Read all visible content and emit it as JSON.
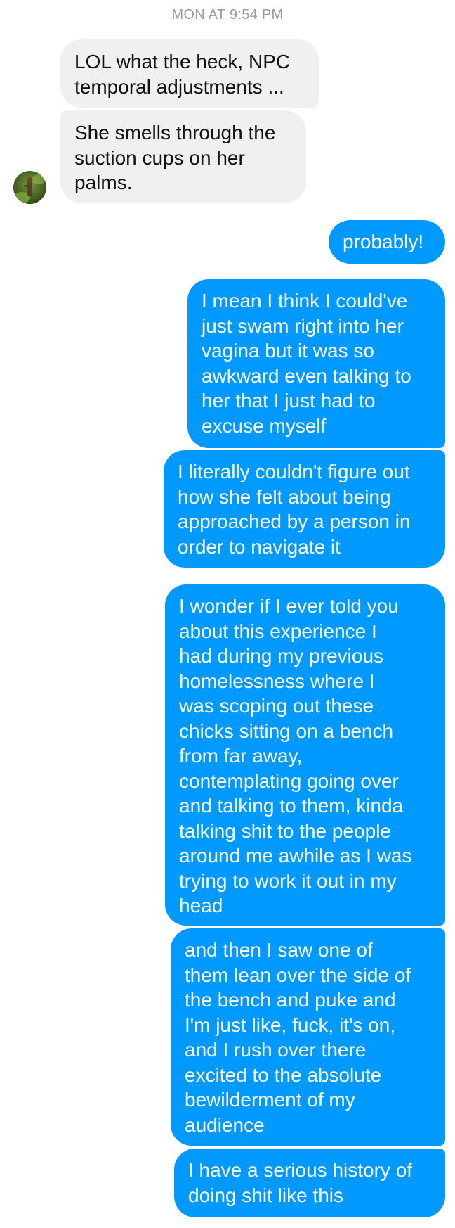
{
  "timestamp": "MON AT 9:54 PM",
  "colors": {
    "incoming_bubble": "#f0f0f0",
    "outgoing_bubble": "#0099ff",
    "timestamp_text": "#9b9b9b"
  },
  "avatar": {
    "icon": "contact-avatar-photo"
  },
  "messages": [
    {
      "direction": "incoming",
      "text": "LOL what the heck, NPC\ntemporal adjustments ..."
    },
    {
      "direction": "incoming",
      "text": "She smells through the\nsuction cups on her\npalms."
    },
    {
      "direction": "outgoing",
      "text": "probably!"
    },
    {
      "direction": "outgoing",
      "text": "I mean I think I could've\njust swam right into her\nvagina but it was so\nawkward even talking to\nher that I just had to\nexcuse myself"
    },
    {
      "direction": "outgoing",
      "text": "I literally couldn't figure out\nhow she felt about being\napproached by a person in\norder to navigate it"
    },
    {
      "direction": "outgoing",
      "text": "I wonder if I ever told you\nabout this experience I\nhad during my previous\nhomelessness where I\nwas scoping out these\nchicks sitting on a bench\nfrom far away,\ncontemplating going over\nand talking to them, kinda\ntalking shit to the people\naround me awhile as I was\ntrying to work it out in my\nhead"
    },
    {
      "direction": "outgoing",
      "text": "and then I saw one of\nthem lean over the side of\nthe bench and puke and\nI'm just like, fuck, it's on,\nand I rush over there\nexcited to the absolute\nbewilderment of my\naudience"
    },
    {
      "direction": "outgoing",
      "text": "I have a serious history of\ndoing shit like this"
    }
  ]
}
